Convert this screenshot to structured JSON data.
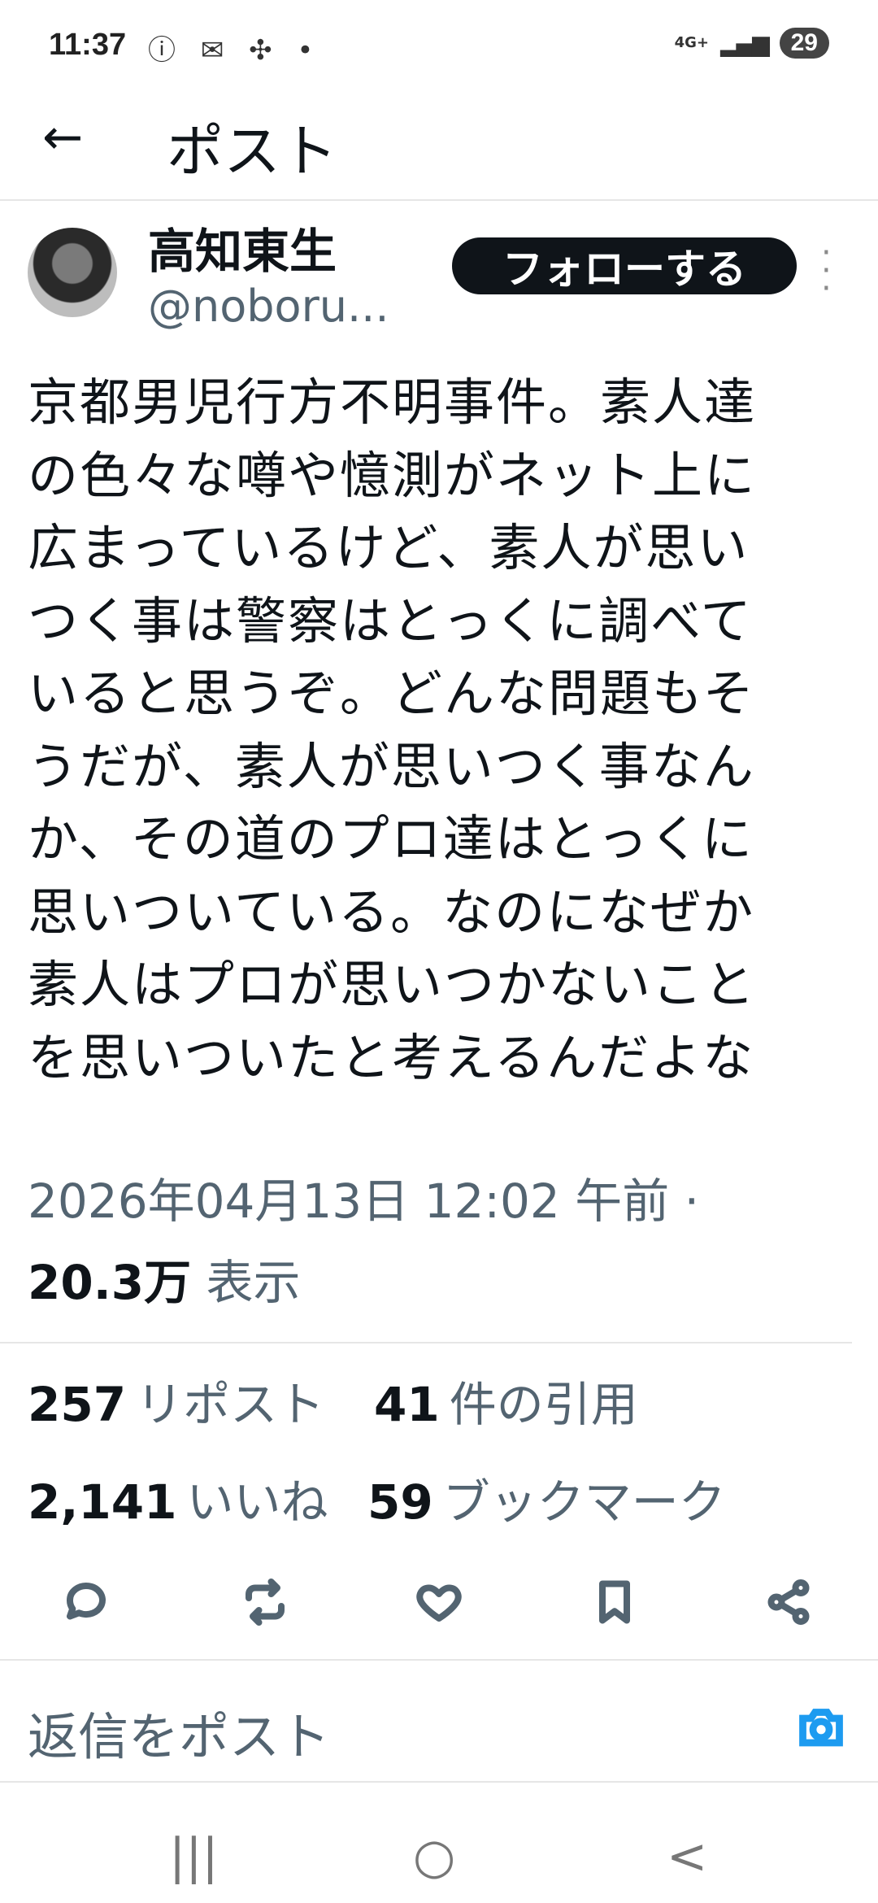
{
  "status_bar": {
    "time": "11:37",
    "icons": "ⓘ ✉ ✣ •",
    "network": "4G+",
    "signal": "▂▄▆",
    "battery": "29"
  },
  "header": {
    "back_icon": "arrow-left-icon",
    "title": "ポスト"
  },
  "author": {
    "name": "高知東生",
    "handle": "@noboru...",
    "follow_label": "フォローする",
    "more_icon": "more-vertical-icon"
  },
  "tweet": {
    "text": "京都男児行方不明事件。素人達\nの色々な噂や憶測がネット上に\n広まっているけど、素人が思い\nつく事は警察はとっくに調べて\nいると思うぞ。どんな問題もそ\nうだが、素人が思いつく事なん\nか、その道のプロ達はとっくに\n思いついている。なのになぜか\n素人はプロが思いつかないこと\nを思いついたと考えるんだよな",
    "timestamp": "2026年04月13日 12:02 午前 ·",
    "views_count": "20.3万",
    "views_label": "表示"
  },
  "stats": {
    "reposts_count": "257",
    "reposts_label": "リポスト",
    "quotes_count": "41",
    "quotes_label": "件の引用",
    "likes_count": "2,141",
    "likes_label": "いいね",
    "bookmarks_count": "59",
    "bookmarks_label": "ブックマーク"
  },
  "actions": [
    "reply-icon",
    "repost-icon",
    "like-icon",
    "bookmark-icon",
    "share-icon"
  ],
  "reply_bar": {
    "placeholder": "返信をポスト",
    "camera_icon": "camera-icon",
    "accent": "#1d9bf0"
  },
  "nav_bar": {
    "recents": "|||",
    "home": "○",
    "back": "<"
  }
}
